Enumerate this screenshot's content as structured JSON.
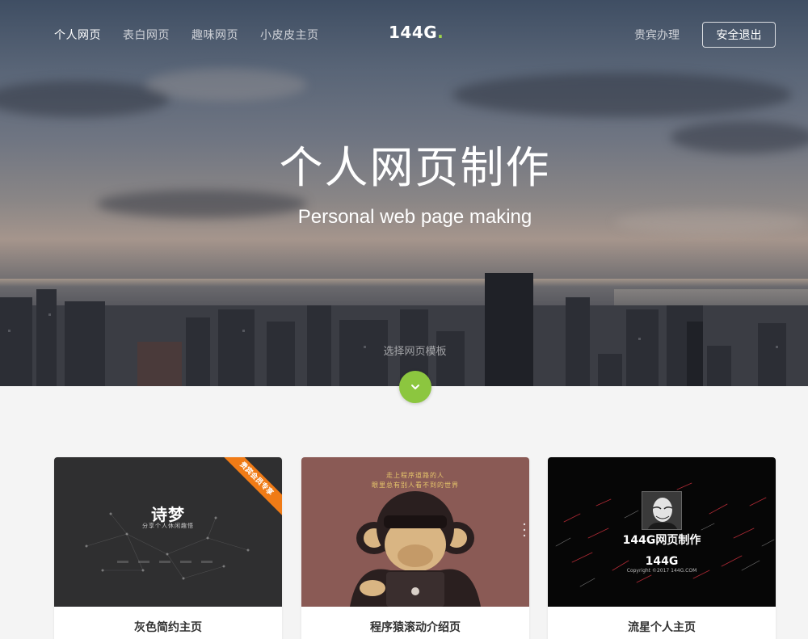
{
  "nav": {
    "items": [
      {
        "label": "个人网页",
        "active": true
      },
      {
        "label": "表白网页",
        "active": false
      },
      {
        "label": "趣味网页",
        "active": false
      },
      {
        "label": "小皮皮主页",
        "active": false
      }
    ],
    "logo_text": "144G",
    "logo_dot": ".",
    "vip_label": "贵宾办理",
    "logout_label": "安全退出"
  },
  "hero": {
    "title": "个人网页制作",
    "subtitle": "Personal web page making",
    "choose_label": "选择网页模板",
    "down_icon": "chevron-down-icon"
  },
  "cards": [
    {
      "caption": "灰色简约主页",
      "thumb_title": "诗梦",
      "thumb_sub": "分享个人休闲趣悟",
      "ribbon": "贵宾会员专享"
    },
    {
      "caption": "程序猿滚动介绍页",
      "thumb_line1": "走上程序道路的人",
      "thumb_line2": "眼里总有别人看不到的世界"
    },
    {
      "caption": "流星个人主页",
      "thumb_name": "144G网页制作",
      "thumb_logo": "144G",
      "thumb_copy": "Copyright  ©2017  144G.COM"
    }
  ],
  "colors": {
    "accent_green": "#8cc63f",
    "ribbon_orange": "#f07b16",
    "card2_bg": "#8a5a55",
    "card1_bg": "#2f2f30",
    "card3_bg": "#060606"
  }
}
